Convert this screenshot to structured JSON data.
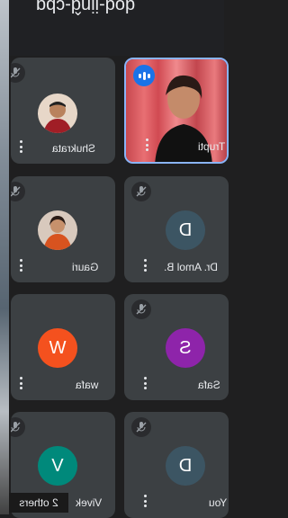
{
  "header": {
    "meeting_code": "dod-ijnd-cbq"
  },
  "tiles": [
    {
      "name": "Trupti",
      "initial": "",
      "avatar_color": "",
      "speaking": true
    },
    {
      "name": "Shukrata",
      "initial": "",
      "avatar_color": ""
    },
    {
      "name": "Dr. Amol B.",
      "initial": "D",
      "avatar_color": "#3c5563"
    },
    {
      "name": "Gauri",
      "initial": "",
      "avatar_color": ""
    },
    {
      "name": "Safa",
      "initial": "S",
      "avatar_color": "#8e24aa"
    },
    {
      "name": "wafa",
      "initial": "W",
      "avatar_color": "#f4511e"
    },
    {
      "name": "You",
      "initial": "D",
      "avatar_color": "#3c5563"
    },
    {
      "name": "Vivek",
      "initial": "V",
      "avatar_color": "#00897b"
    }
  ],
  "others": {
    "label": "2 others"
  }
}
